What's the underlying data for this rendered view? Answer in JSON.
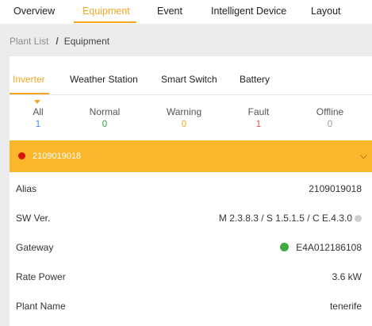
{
  "top_nav": {
    "tabs": [
      {
        "label": "Overview"
      },
      {
        "label": "Equipment"
      },
      {
        "label": "Event"
      },
      {
        "label": "Intelligent Device"
      },
      {
        "label": "Layout"
      }
    ],
    "active_tab": "Equipment"
  },
  "breadcrumb": {
    "parent": "Plant List",
    "separator": "/",
    "current": "Equipment"
  },
  "device_tabs": {
    "items": [
      {
        "label": "Inverter"
      },
      {
        "label": "Weather Station"
      },
      {
        "label": "Smart Switch"
      },
      {
        "label": "Battery"
      }
    ],
    "active_tab": "Inverter"
  },
  "status_summary": [
    {
      "label": "All",
      "count": "1",
      "color": "#3a8ee6"
    },
    {
      "label": "Normal",
      "count": "0",
      "color": "#2ea043"
    },
    {
      "label": "Warning",
      "count": "0",
      "color": "#f5a623"
    },
    {
      "label": "Fault",
      "count": "1",
      "color": "#e5534b"
    },
    {
      "label": "Offline",
      "count": "0",
      "color": "#9a9a9a"
    }
  ],
  "device": {
    "serial": "2109019018",
    "status_color": "#d9140f",
    "header_color": "#fbb62b",
    "chevron_icon": "chevron-down-icon",
    "fields": [
      {
        "key": "Alias",
        "value": "2109019018"
      },
      {
        "key": "SW Ver.",
        "value": "M 2.3.8.3 / S  1.5.1.5 / C E.4.3.0",
        "icon": "info-icon"
      },
      {
        "key": "Gateway",
        "value": "E4A012186108",
        "icon": "status-dot-icon",
        "status_color": "#3dab3d"
      },
      {
        "key": "Rate Power",
        "value": "3.6 kW"
      },
      {
        "key": "Plant Name",
        "value": "tenerife"
      }
    ]
  },
  "colors": {
    "accent": "#f5a623",
    "background": "#ececec"
  }
}
